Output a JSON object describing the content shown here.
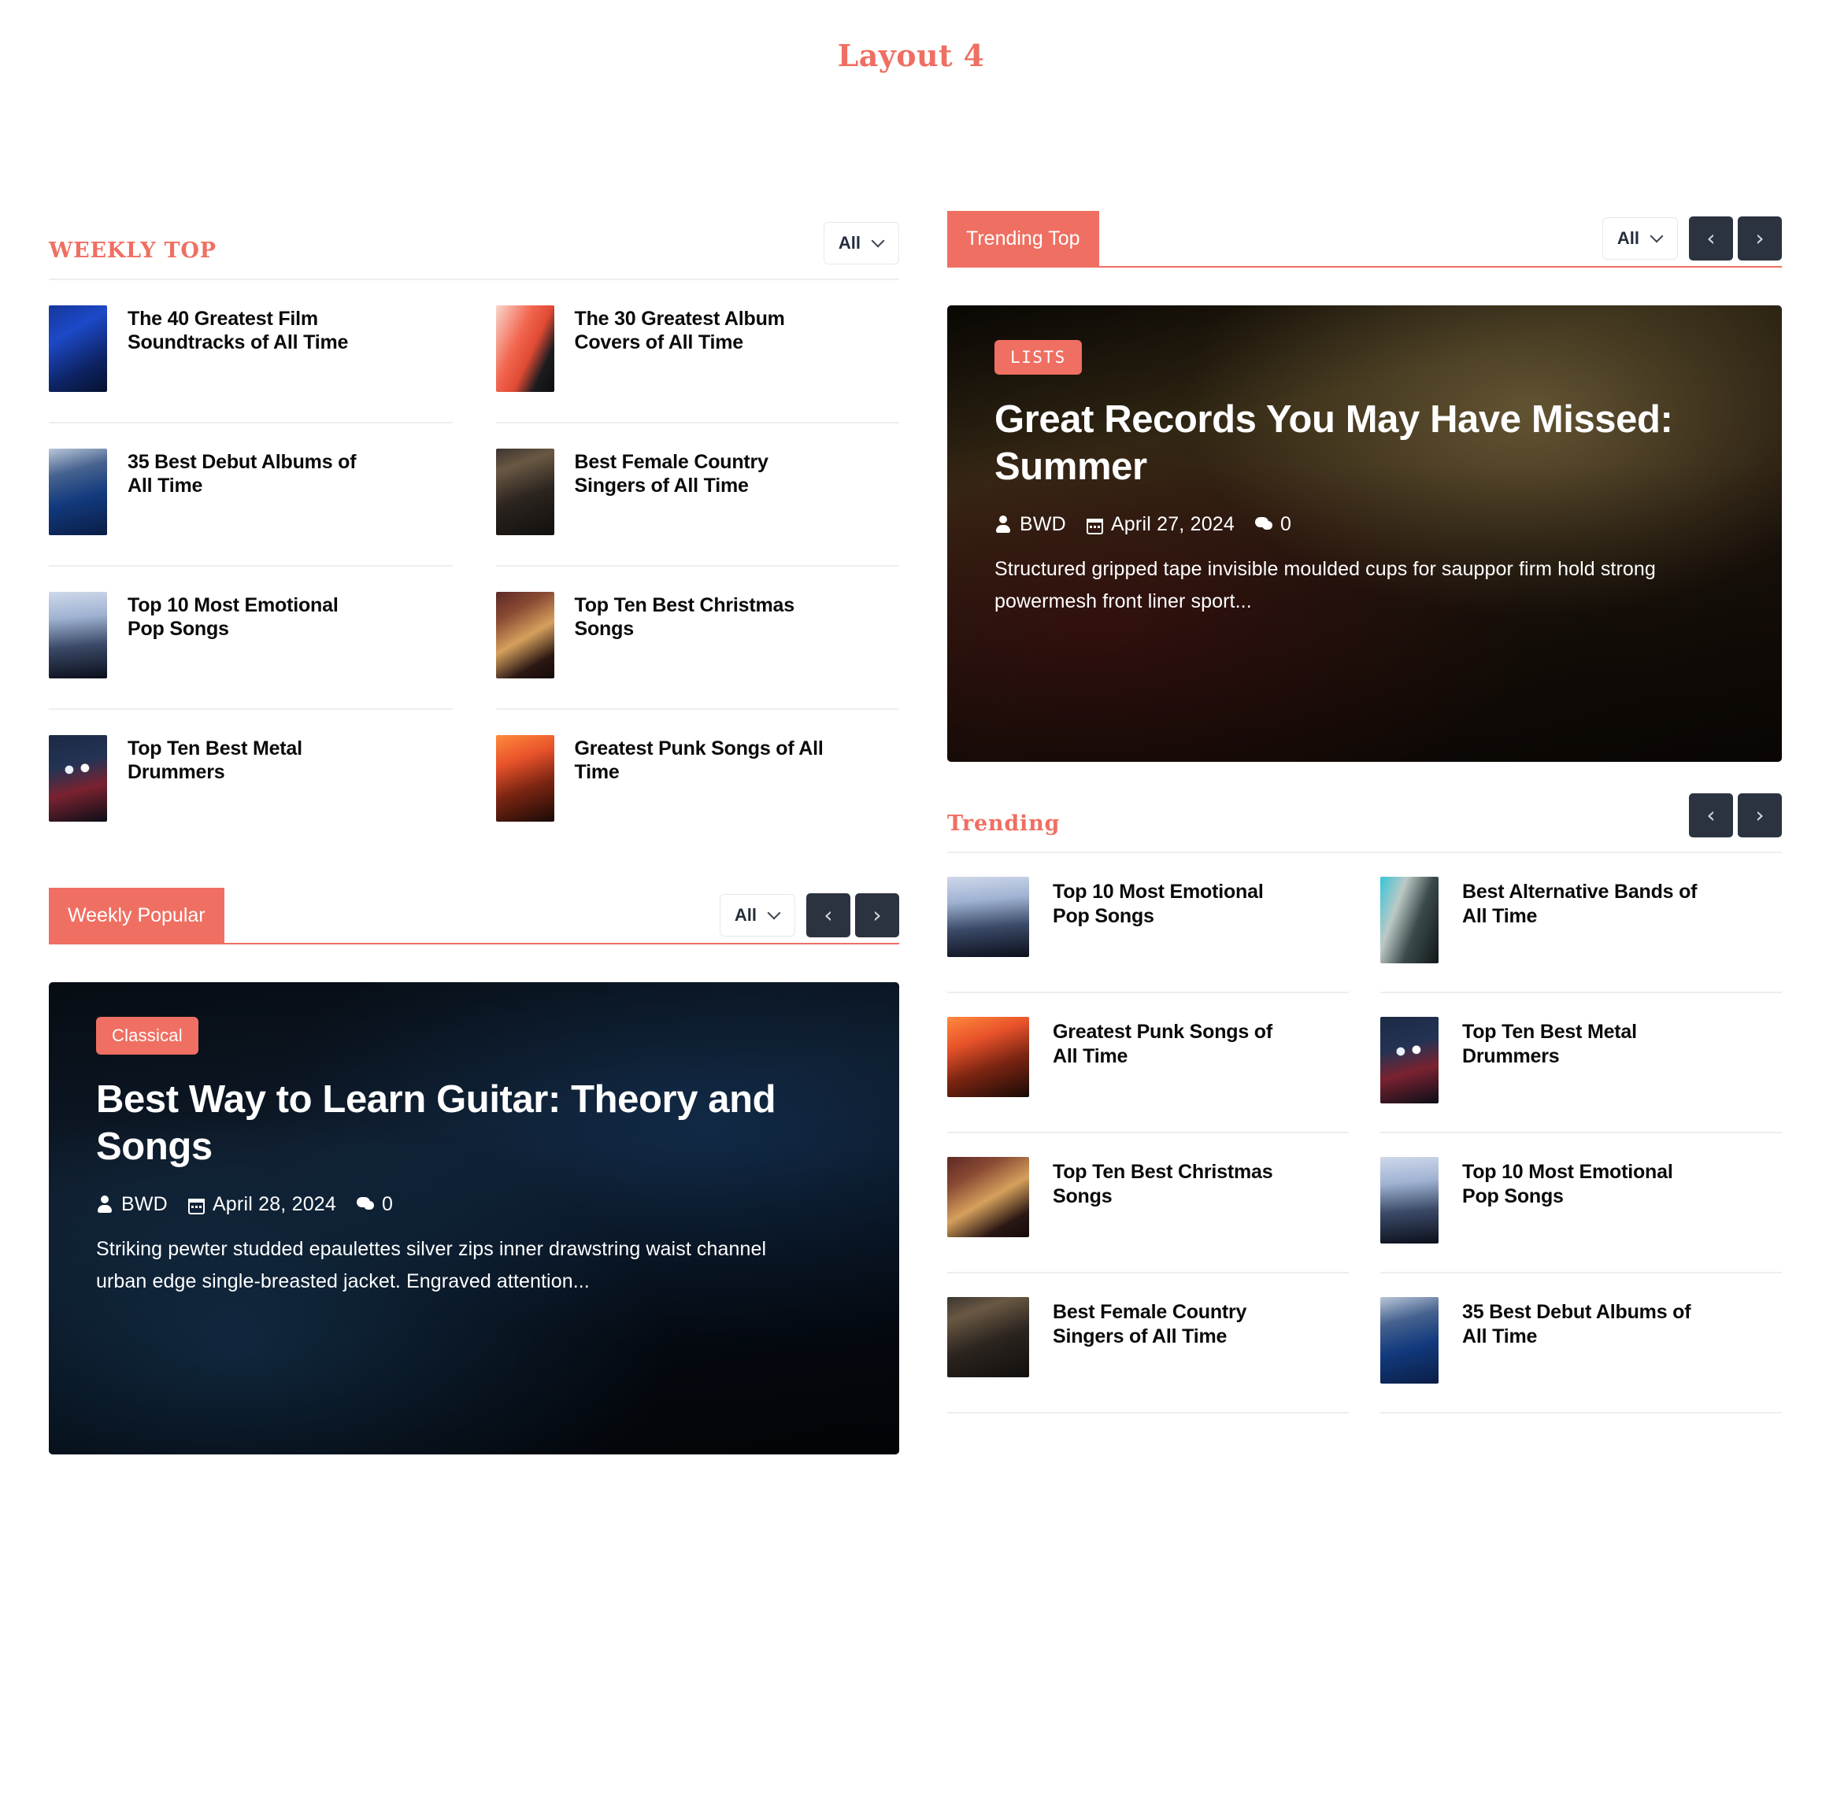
{
  "page": {
    "title": "Layout 4",
    "accent_color": "#ef6f62",
    "nav_button_color": "#2b3340"
  },
  "icons": {
    "chevron_down": "chevron-down-icon",
    "prev": "‹",
    "next": "›"
  },
  "weekly_top": {
    "heading": "Weekly Top",
    "filter_value": "All",
    "items": [
      {
        "title": "The 40 Greatest Film Soundtracks of All Time"
      },
      {
        "title": "The 30 Greatest Album Covers of All Time"
      },
      {
        "title": "35 Best Debut Albums of All Time"
      },
      {
        "title": "Best Female Country Singers of All Time"
      },
      {
        "title": "Top 10 Most Emotional Pop Songs"
      },
      {
        "title": "Top Ten Best Christmas Songs"
      },
      {
        "title": "Top Ten Best Metal Drummers"
      },
      {
        "title": "Greatest Punk Songs of All Time"
      }
    ]
  },
  "weekly_popular": {
    "heading": "Weekly Popular",
    "filter_value": "All",
    "hero": {
      "category": "Classical",
      "title": "Best Way to Learn Guitar: Theory and Songs",
      "author": "BWD",
      "date": "April 28, 2024",
      "comments": "0",
      "excerpt": "Striking pewter studded epaulettes silver zips inner drawstring waist channel urban edge single-breasted jacket. Engraved attention..."
    }
  },
  "trending_top": {
    "heading": "Trending Top",
    "filter_value": "All",
    "hero": {
      "category": "LISTS",
      "title": "Great Records You May Have Missed: Summer",
      "author": "BWD",
      "date": "April 27, 2024",
      "comments": "0",
      "excerpt": "Structured gripped tape invisible moulded cups for sauppor firm hold strong powermesh front liner sport..."
    }
  },
  "trending": {
    "heading": "Trending",
    "items": [
      {
        "title": "Top 10 Most Emotional Pop Songs"
      },
      {
        "title": "Best Alternative Bands of All Time"
      },
      {
        "title": "Greatest Punk Songs of All Time"
      },
      {
        "title": "Top Ten Best Metal Drummers"
      },
      {
        "title": "Top Ten Best Christmas Songs"
      },
      {
        "title": "Top 10 Most Emotional Pop Songs"
      },
      {
        "title": "Best Female Country Singers of All Time"
      },
      {
        "title": "35 Best Debut Albums of All Time"
      }
    ]
  }
}
